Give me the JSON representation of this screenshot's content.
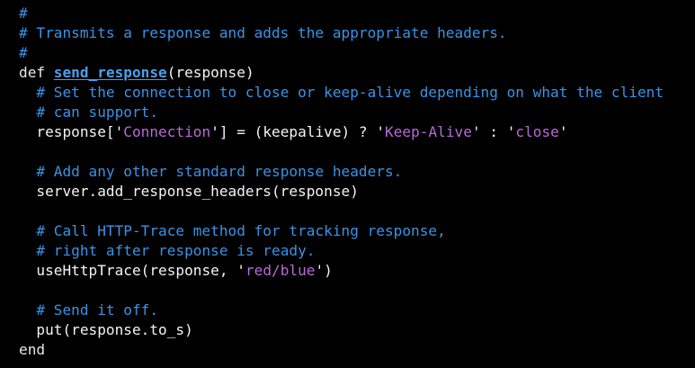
{
  "theme": {
    "background": "#000000",
    "foreground": "#f4f4f4",
    "comment": "#3a93e6",
    "function_name": "#4a9ff0",
    "string": "#b86ad8"
  },
  "code": {
    "lines": [
      [
        {
          "t": "comment",
          "v": "#"
        }
      ],
      [
        {
          "t": "comment",
          "v": "# Transmits a response and adds the appropriate headers."
        }
      ],
      [
        {
          "t": "comment",
          "v": "#"
        }
      ],
      [
        {
          "t": "keyword",
          "v": "def "
        },
        {
          "t": "funcname",
          "v": "send_response"
        },
        {
          "t": "plain",
          "v": "(response)"
        }
      ],
      [
        {
          "t": "plain",
          "v": "  "
        },
        {
          "t": "comment",
          "v": "# Set the connection to close or keep-alive depending on what the client"
        }
      ],
      [
        {
          "t": "plain",
          "v": "  "
        },
        {
          "t": "comment",
          "v": "# can support."
        }
      ],
      [
        {
          "t": "plain",
          "v": "  response["
        },
        {
          "t": "quote",
          "v": "'"
        },
        {
          "t": "string",
          "v": "Connection"
        },
        {
          "t": "quote",
          "v": "'"
        },
        {
          "t": "plain",
          "v": "] = (keepalive) ? "
        },
        {
          "t": "quote",
          "v": "'"
        },
        {
          "t": "string",
          "v": "Keep-Alive"
        },
        {
          "t": "quote",
          "v": "'"
        },
        {
          "t": "plain",
          "v": " : "
        },
        {
          "t": "quote",
          "v": "'"
        },
        {
          "t": "string",
          "v": "close"
        },
        {
          "t": "quote",
          "v": "'"
        }
      ],
      [],
      [
        {
          "t": "plain",
          "v": "  "
        },
        {
          "t": "comment",
          "v": "# Add any other standard response headers."
        }
      ],
      [
        {
          "t": "plain",
          "v": "  server.add_response_headers(response)"
        }
      ],
      [],
      [
        {
          "t": "plain",
          "v": "  "
        },
        {
          "t": "comment",
          "v": "# Call HTTP-Trace method for tracking response,"
        }
      ],
      [
        {
          "t": "plain",
          "v": "  "
        },
        {
          "t": "comment",
          "v": "# right after response is ready."
        }
      ],
      [
        {
          "t": "plain",
          "v": "  useHttpTrace(response, "
        },
        {
          "t": "quote",
          "v": "'"
        },
        {
          "t": "string",
          "v": "red/blue"
        },
        {
          "t": "quote",
          "v": "'"
        },
        {
          "t": "plain",
          "v": ")"
        }
      ],
      [],
      [
        {
          "t": "plain",
          "v": "  "
        },
        {
          "t": "comment",
          "v": "# Send it off."
        }
      ],
      [
        {
          "t": "plain",
          "v": "  put(response.to_s)"
        }
      ],
      [
        {
          "t": "keyword",
          "v": "end"
        }
      ]
    ]
  }
}
